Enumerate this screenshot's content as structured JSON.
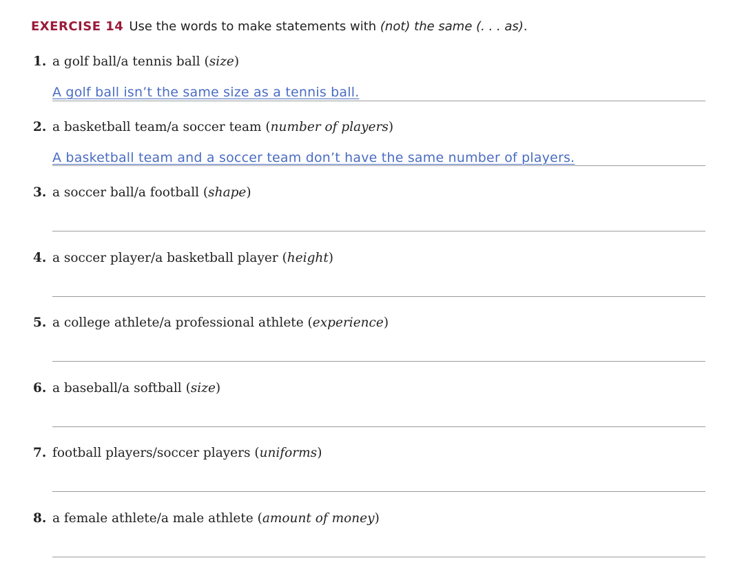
{
  "exercise": {
    "label": "EXERCISE 14",
    "instruction_before": "Use the words to make statements with ",
    "instruction_italic": "(not) the same (. . . as)",
    "instruction_after": "."
  },
  "items": [
    {
      "num": "1.",
      "prompt": "a golf ball/a tennis ball (",
      "hint": "size",
      "close": ")",
      "answer": "A golf ball isn’t the same size as a tennis ball."
    },
    {
      "num": "2.",
      "prompt": "a basketball team/a soccer team (",
      "hint": "number of players",
      "close": ")",
      "answer": "A basketball team and a soccer team don’t have the same number of players."
    },
    {
      "num": "3.",
      "prompt": "a soccer ball/a football (",
      "hint": "shape",
      "close": ")",
      "answer": ""
    },
    {
      "num": "4.",
      "prompt": "a soccer player/a basketball player (",
      "hint": "height",
      "close": ")",
      "answer": ""
    },
    {
      "num": "5.",
      "prompt": "a college athlete/a professional athlete (",
      "hint": "experience",
      "close": ")",
      "answer": ""
    },
    {
      "num": "6.",
      "prompt": "a baseball/a softball (",
      "hint": "size",
      "close": ")",
      "answer": ""
    },
    {
      "num": "7.",
      "prompt": "football players/soccer players (",
      "hint": "uniforms",
      "close": ")",
      "answer": ""
    },
    {
      "num": "8.",
      "prompt": "a female athlete/a male athlete (",
      "hint": "amount of money",
      "close": ")",
      "answer": ""
    }
  ]
}
